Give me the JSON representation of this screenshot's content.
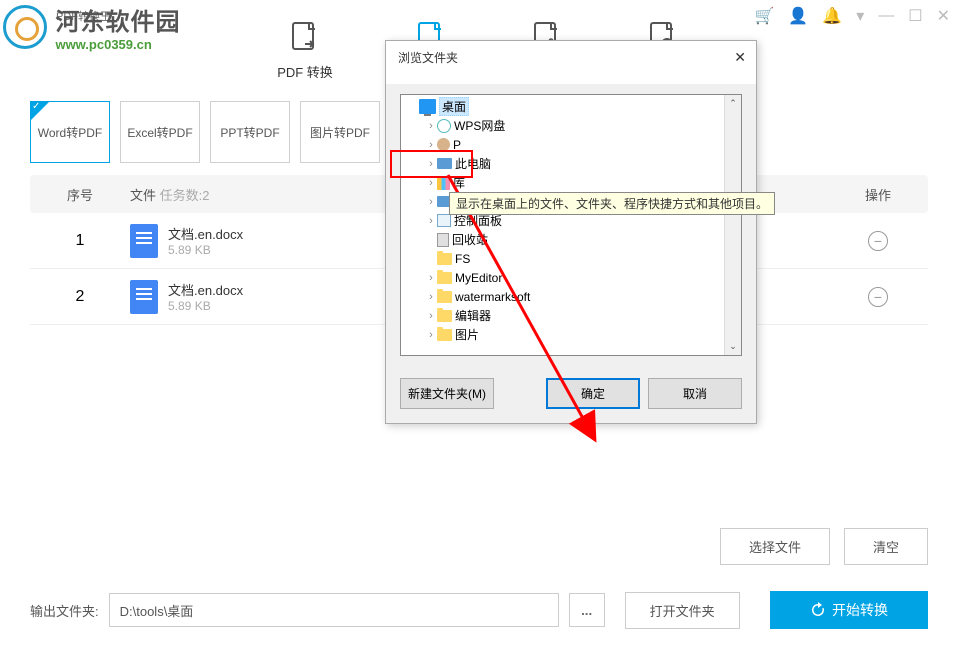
{
  "watermark": {
    "title": "河东软件园",
    "url": "www.pc0359.cn"
  },
  "app_title": "PDF转换王",
  "toolbar": {
    "items": [
      {
        "label": "PDF 转换"
      },
      {
        "label": ""
      },
      {
        "label": ""
      },
      {
        "label": ""
      }
    ]
  },
  "tabs": [
    {
      "label": "Word转PDF"
    },
    {
      "label": "Excel转PDF"
    },
    {
      "label": "PPT转PDF"
    },
    {
      "label": "图片转PDF"
    }
  ],
  "table": {
    "headers": {
      "seq": "序号",
      "file": "文件",
      "tasks": "任务数:2",
      "op": "操作"
    },
    "rows": [
      {
        "seq": "1",
        "name": "文档.en.docx",
        "size": "5.89 KB"
      },
      {
        "seq": "2",
        "name": "文档.en.docx",
        "size": "5.89 KB"
      }
    ]
  },
  "buttons": {
    "select_file": "选择文件",
    "clear": "清空",
    "open_folder": "打开文件夹",
    "start": "开始转换"
  },
  "output": {
    "label": "输出文件夹:",
    "path": "D:\\tools\\桌面",
    "browse": "..."
  },
  "dialog": {
    "title": "浏览文件夹",
    "tree": [
      {
        "label": "桌面",
        "indent": 0,
        "icon": "desktop",
        "expander": "",
        "selected": true
      },
      {
        "label": "WPS网盘",
        "indent": 1,
        "icon": "wps",
        "expander": "›"
      },
      {
        "label": "P",
        "indent": 1,
        "icon": "user",
        "expander": "›"
      },
      {
        "label": "此电脑",
        "indent": 1,
        "icon": "pc",
        "expander": "›"
      },
      {
        "label": "库",
        "indent": 1,
        "icon": "lib",
        "expander": "›"
      },
      {
        "label": "网络",
        "indent": 1,
        "icon": "net",
        "expander": "›"
      },
      {
        "label": "控制面板",
        "indent": 1,
        "icon": "ctrl",
        "expander": "›"
      },
      {
        "label": "回收站",
        "indent": 1,
        "icon": "recycle",
        "expander": ""
      },
      {
        "label": "FS",
        "indent": 1,
        "icon": "folder",
        "expander": ""
      },
      {
        "label": "MyEditor",
        "indent": 1,
        "icon": "folder",
        "expander": "›"
      },
      {
        "label": "watermarksoft",
        "indent": 1,
        "icon": "folder",
        "expander": "›"
      },
      {
        "label": "编辑器",
        "indent": 1,
        "icon": "folder",
        "expander": "›"
      },
      {
        "label": "图片",
        "indent": 1,
        "icon": "folder",
        "expander": "›"
      }
    ],
    "tooltip": "显示在桌面上的文件、文件夹、程序快捷方式和其他项目。",
    "new_folder": "新建文件夹(M)",
    "ok": "确定",
    "cancel": "取消"
  }
}
